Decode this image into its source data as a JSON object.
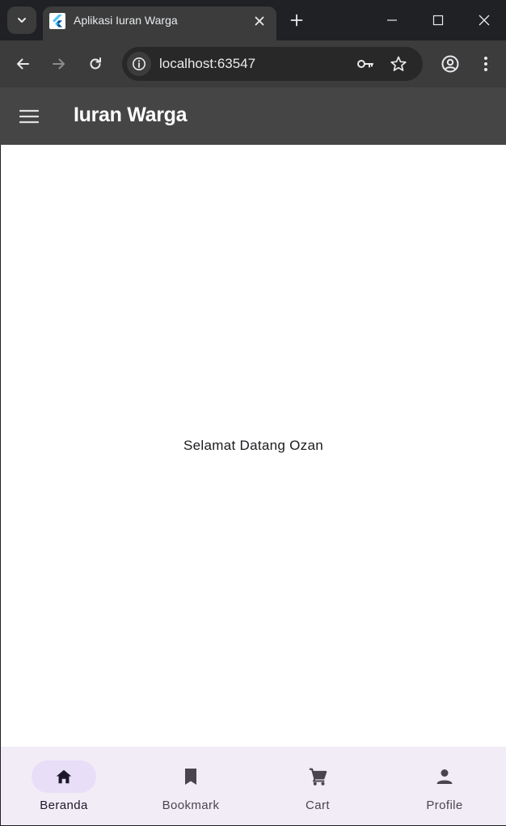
{
  "browser": {
    "tab": {
      "title": "Aplikasi Iuran Warga",
      "favicon": "flutter-logo-icon"
    },
    "omnibox": {
      "url": "localhost:63547"
    },
    "icons": {
      "tab_list": "chevron-down-icon",
      "new_tab": "plus-icon",
      "back": "arrow-left-icon",
      "forward": "arrow-right-icon",
      "reload": "reload-icon",
      "site_info": "info-icon",
      "password": "key-icon",
      "bookmark": "star-icon",
      "profile": "account-circle-icon",
      "menu": "more-vert-icon"
    }
  },
  "app": {
    "title": "Iuran Warga",
    "welcome_text": "Selamat Datang Ozan",
    "bottom_nav": [
      {
        "label": "Beranda",
        "icon": "home-icon",
        "active": true
      },
      {
        "label": "Bookmark",
        "icon": "bookmark-icon",
        "active": false
      },
      {
        "label": "Cart",
        "icon": "cart-icon",
        "active": false
      },
      {
        "label": "Profile",
        "icon": "person-icon",
        "active": false
      }
    ]
  },
  "colors": {
    "browser_frame": "#202124",
    "toolbar": "#3c3c3c",
    "appbar": "#454545",
    "bottom_nav_bg": "#f2ecf7",
    "active_indicator": "#e8def8",
    "nav_icon": "#49454f"
  }
}
